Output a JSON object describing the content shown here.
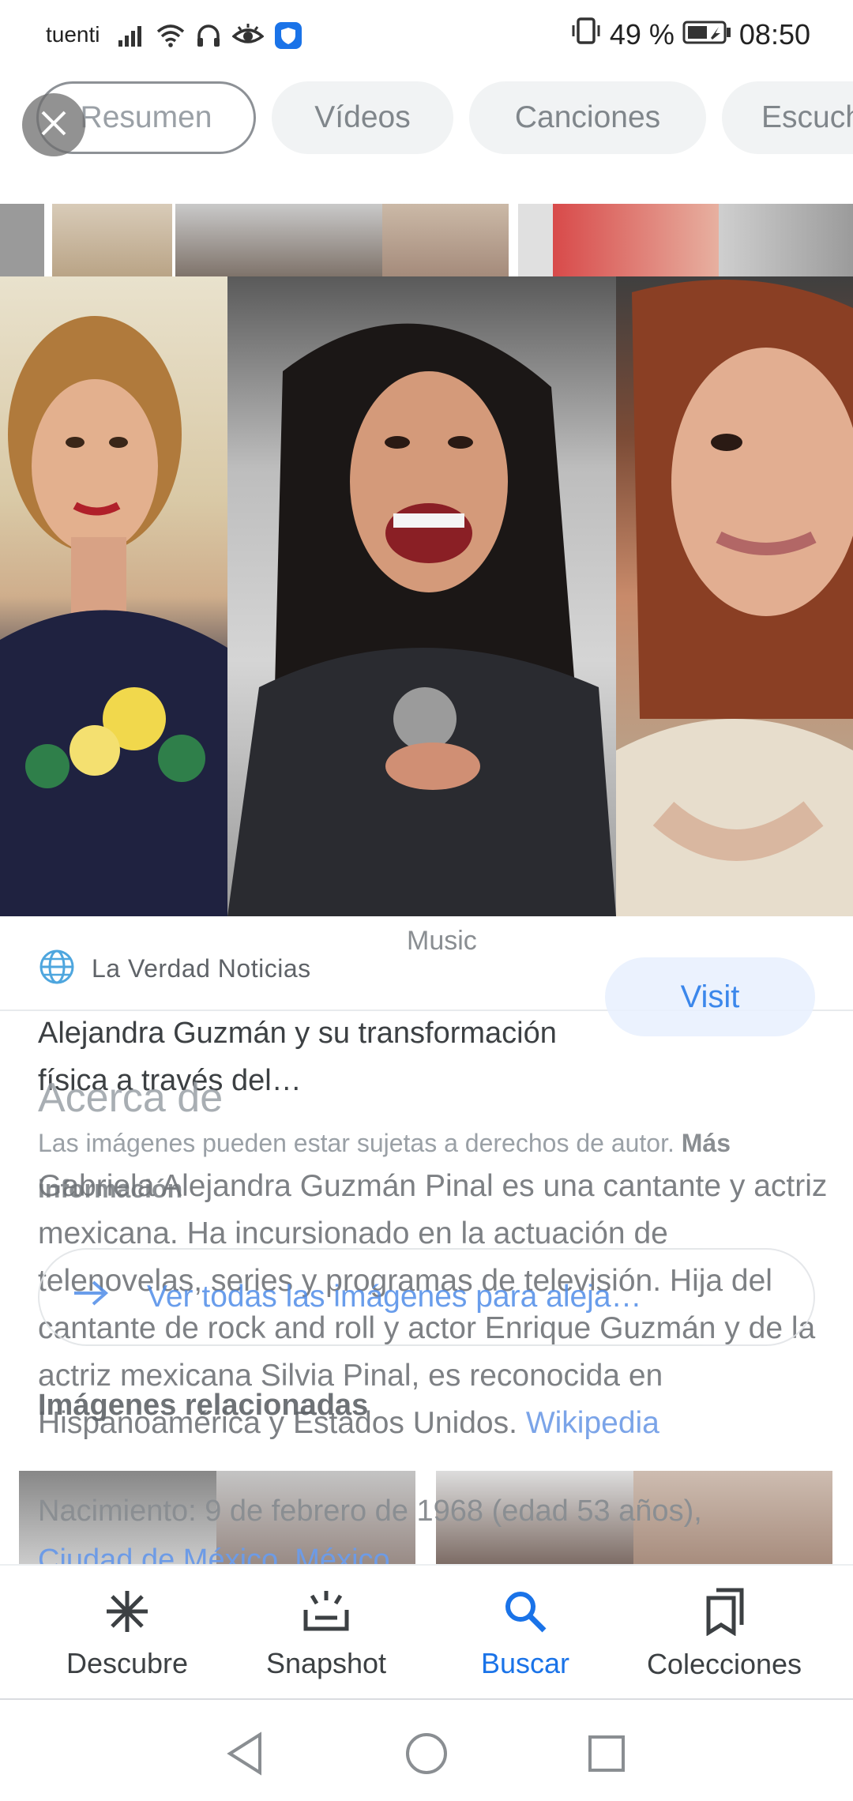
{
  "status_bar": {
    "carrier": "tuenti",
    "battery": "49 %",
    "time": "08:50"
  },
  "chips": [
    "Resumen",
    "Vídeos",
    "Canciones",
    "Escuchar"
  ],
  "active_chip": "Resumen",
  "result": {
    "category_label": "Music",
    "source": "La Verdad Noticias",
    "visit_label": "Visit",
    "title": "Alejandra Guzmán y su transformación física a través del…",
    "copyright_text": "Las imágenes pueden estar sujetas a derechos de autor.",
    "more_info": "Más información"
  },
  "about": {
    "heading": "Acerca de",
    "bio": "Gabriela Alejandra Guzmán Pinal es una cantante y actriz mexicana. Ha incursionado en la actuación de telenovelas, series y programas de televisión. Hija del cantante de rock and roll y actor Enrique Guzmán y de la actriz mexicana Silvia Pinal, es reconocida en Hispanoamérica y Estados Unidos.",
    "wiki_link": "Wikipedia",
    "birth_label": "Nacimiento:",
    "birth_value": "9 de febrero de 1968 (edad 53 años),",
    "birth_place": "Ciudad de México, México"
  },
  "see_all_label": "Ver todas las imágenes para aleja…",
  "related_title": "Imágenes relacionadas",
  "bottom_nav": [
    {
      "label": "Descubre",
      "icon": "asterisk-icon"
    },
    {
      "label": "Snapshot",
      "icon": "snapshot-icon"
    },
    {
      "label": "Buscar",
      "icon": "search-icon"
    },
    {
      "label": "Colecciones",
      "icon": "collections-icon"
    }
  ],
  "active_nav": "Buscar",
  "colors": {
    "accent": "#1a73e8",
    "chip_bg": "#f1f3f4",
    "link": "#6d9be6"
  }
}
